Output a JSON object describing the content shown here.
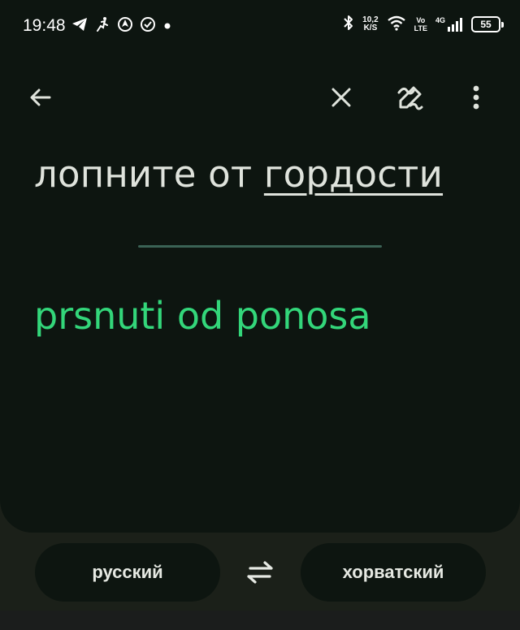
{
  "status_bar": {
    "time": "19:48",
    "net_speed_value": "10,2",
    "net_speed_unit": "K/S",
    "volte_top": "Vo",
    "volte_bottom": "LTE",
    "network_type": "4G",
    "battery": "55",
    "left_icons": [
      "telegram-icon",
      "activity-icon",
      "vpn-icon",
      "sync-icon",
      "dot-icon"
    ],
    "right_icons": [
      "bluetooth-icon",
      "wifi-icon",
      "signal-icon"
    ]
  },
  "toolbar": {
    "back_icon": "back-arrow-icon",
    "clear_icon": "close-icon",
    "handwriting_icon": "handwriting-icon",
    "more_icon": "more-vert-icon"
  },
  "source": {
    "prefix": "лопните от ",
    "underlined_word": "гордости"
  },
  "translation": {
    "text": "prsnuti od ponosa"
  },
  "languages": {
    "source_label": "русский",
    "target_label": "хорватский",
    "swap_icon": "swap-arrows-icon"
  },
  "colors": {
    "background": "#0d1510",
    "translation_accent": "#33d67a",
    "divider": "#3a6255",
    "text": "#dfe3dc"
  }
}
